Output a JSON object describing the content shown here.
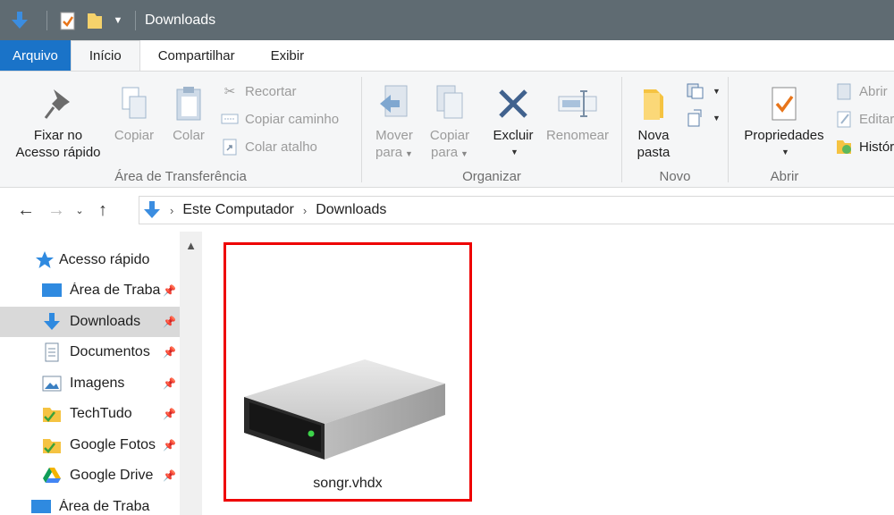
{
  "window": {
    "title": "Downloads"
  },
  "tabs": [
    "Arquivo",
    "Início",
    "Compartilhar",
    "Exibir"
  ],
  "ribbon": {
    "clipboard": {
      "label": "Área de Transferência",
      "pin": [
        "Fixar no",
        "Acesso rápido"
      ],
      "copy": "Copiar",
      "paste": "Colar",
      "cut": "Recortar",
      "copy_path": "Copiar caminho",
      "paste_shortcut": "Colar atalho"
    },
    "organize": {
      "label": "Organizar",
      "move_to": [
        "Mover",
        "para"
      ],
      "copy_to": [
        "Copiar",
        "para"
      ],
      "delete": "Excluir",
      "rename": "Renomear"
    },
    "new": {
      "label": "Novo",
      "new_folder": [
        "Nova",
        "pasta"
      ]
    },
    "open": {
      "label": "Abrir",
      "properties": "Propriedades",
      "open": "Abrir",
      "edit": "Editar",
      "history": "Histórico"
    }
  },
  "address": {
    "crumbs": [
      "Este Computador",
      "Downloads"
    ]
  },
  "nav": {
    "quick_access": "Acesso rápido",
    "items": [
      {
        "label": "Área de Trabalho",
        "icon": "desktop-icon"
      },
      {
        "label": "Downloads",
        "icon": "download-arrow-icon"
      },
      {
        "label": "Documentos",
        "icon": "documents-icon"
      },
      {
        "label": "Imagens",
        "icon": "pictures-icon"
      },
      {
        "label": "TechTudo",
        "icon": "folder-check-icon"
      },
      {
        "label": "Google Fotos",
        "icon": "folder-check-icon"
      },
      {
        "label": "Google Drive",
        "icon": "google-drive-icon"
      },
      {
        "label": "Área de Trabalho",
        "icon": "desktop-icon"
      }
    ],
    "selected_index": 1
  },
  "files": [
    {
      "name": "songr.vhdx",
      "icon": "virtual-disk-icon",
      "highlighted": true
    }
  ],
  "colors": {
    "titlebar": "#5f6b72",
    "file_tab": "#1a73c8",
    "highlight_border": "#e00000",
    "selected_nav": "#d9d9d9"
  }
}
